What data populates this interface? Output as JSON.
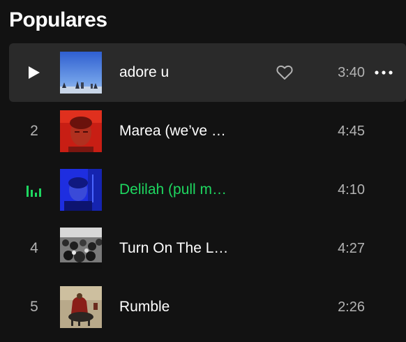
{
  "section": {
    "title": "Populares"
  },
  "tracks": [
    {
      "index": "1",
      "title": "adore u",
      "duration": "3:40"
    },
    {
      "index": "2",
      "title": "Marea (we’ve …",
      "duration": "4:45"
    },
    {
      "index": "3",
      "title": "Delilah (pull m…",
      "duration": "4:10"
    },
    {
      "index": "4",
      "title": "Turn On The L…",
      "duration": "4:27"
    },
    {
      "index": "5",
      "title": "Rumble",
      "duration": "2:26"
    }
  ],
  "colors": {
    "background": "#121212",
    "row_hover": "#2a2a2a",
    "playing_accent": "#1ed760",
    "text_primary": "#ffffff",
    "text_secondary": "#b3b3b3"
  },
  "icons": {
    "row_1_state": "play-icon",
    "row_3_state": "equalizer-icon",
    "like": "heart-outline-icon",
    "more": "more-options-icon"
  }
}
